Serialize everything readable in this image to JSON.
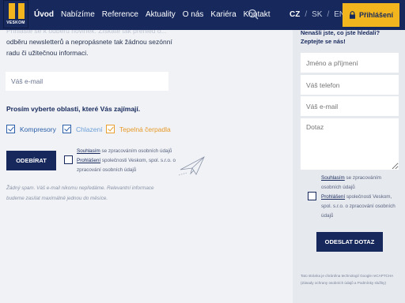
{
  "brand": {
    "name": "VESKOM"
  },
  "nav": {
    "items": [
      "Úvod",
      "Nabízíme",
      "Reference",
      "Aktuality",
      "O nás",
      "Kariéra",
      "Kontakt"
    ],
    "active": "Úvod"
  },
  "languages": {
    "cz": "CZ",
    "sk": "SK",
    "en": "EN",
    "separator": "/"
  },
  "login": {
    "label": "Přihlášení"
  },
  "newsletter": {
    "intro_faded": "Přihlaste se k odběru novinek. Získáte tak přehled o...",
    "intro": "odběru newsletterů a nepropásnete tak žádnou sezónní radu či užitečnou informaci.",
    "email_placeholder": "Váš e-mail",
    "areas_title": "Prosím vyberte oblasti, které Vás zajímají.",
    "areas": [
      "Kompresory",
      "Chlazení",
      "Tepelná čerpadla"
    ],
    "subscribe_label": "ODEBÍRAT",
    "consent": {
      "link1": "Souhlasím",
      "text1": " se zpracováním osobních údajů",
      "link2": "Prohlášení",
      "text2": " společnosti Veskom, spol. s.r.o. o zpracování osobních údajů"
    },
    "spam_note": "Žádný spam. Váš e-mail nikomu nepředáme. Relevantní informace budeme zasílat maximálně jednou do měsíce."
  },
  "contact": {
    "title": "Nenašli jste, co jste hledali? Zeptejte se nás!",
    "name_placeholder": "Jméno a příjmení",
    "phone_placeholder": "Váš telefon",
    "email_placeholder": "Váš e-mail",
    "question_placeholder": "Dotaz",
    "consent": {
      "link1": "Souhlasím",
      "text1": " se zpracováním osobních údajů",
      "link2": "Prohlášení",
      "text2": " společnosti Veskom, spol. s.r.o. o zpracování osobních údajů"
    },
    "send_label": "ODESLAT DOTAZ",
    "recaptcha_note": "Tato stránka je chráněna technologií Google reCAPTCHA (Zásady ochrany osobních údajů a Podmínky služby)"
  },
  "colors": {
    "primary": "#16285c",
    "accent": "#f2b51e",
    "orange": "#e89a2a",
    "blue": "#2b5faa"
  }
}
